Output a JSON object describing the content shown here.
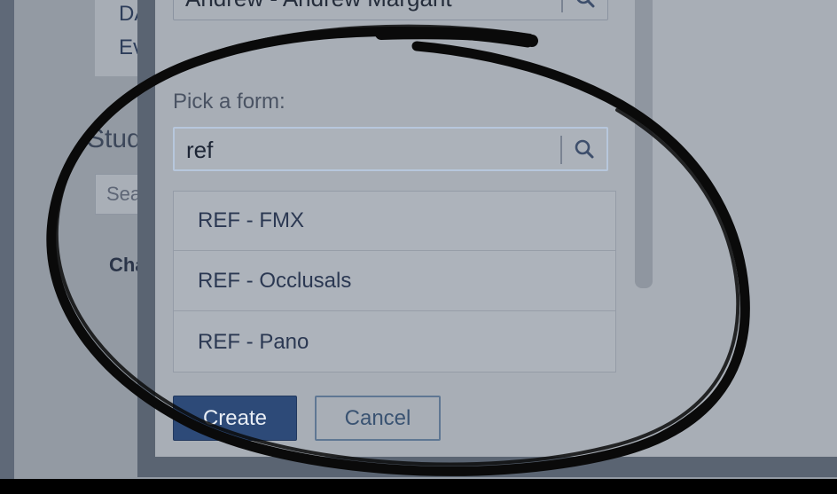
{
  "background": {
    "card_lines": [
      "DAC",
      "Eva"
    ],
    "section_heading_partial": "Stud",
    "search_placeholder_partial": "Searc",
    "chart_label_partial": "Chai"
  },
  "modal": {
    "patient_field": {
      "value": "Andrew - Andrew Margant"
    },
    "form_picker": {
      "label": "Pick a form:",
      "query": "ref"
    },
    "results": [
      {
        "label": "REF - FMX"
      },
      {
        "label": "REF - Occlusals"
      },
      {
        "label": "REF - Pano"
      }
    ],
    "create_label": "Create",
    "cancel_label": "Cancel"
  },
  "colors": {
    "primary_button": "#2d4a78",
    "annotation_ink": "#0a0a0a"
  },
  "icons": {
    "search": "search-icon"
  }
}
